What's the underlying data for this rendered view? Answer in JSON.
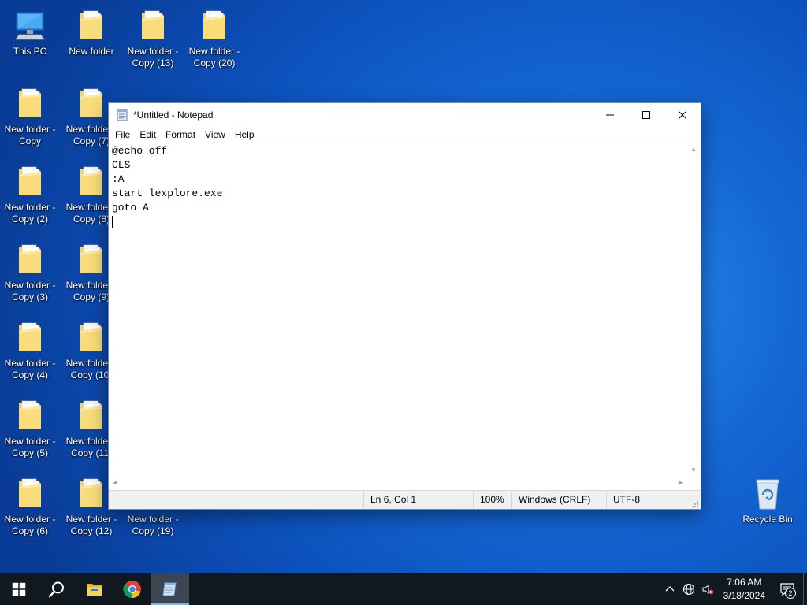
{
  "desktop": {
    "icons": [
      {
        "label": "This PC",
        "type": "pc"
      },
      {
        "label": "New folder",
        "type": "folder"
      },
      {
        "label": "New folder -\nCopy (13)",
        "type": "folder"
      },
      {
        "label": "New folder -\nCopy (20)",
        "type": "folder"
      },
      {
        "label": "New folder -\nCopy",
        "type": "folder"
      },
      {
        "label": "New folder -\nCopy (7)",
        "type": "folder"
      },
      {
        "label": "New folder -\nCopy (2)",
        "type": "folder"
      },
      {
        "label": "New folder -\nCopy (8)",
        "type": "folder"
      },
      {
        "label": "New folder -\nCopy (3)",
        "type": "folder"
      },
      {
        "label": "New folder -\nCopy (9)",
        "type": "folder"
      },
      {
        "label": "New folder -\nCopy (4)",
        "type": "folder"
      },
      {
        "label": "New folder -\nCopy (10)",
        "type": "folder"
      },
      {
        "label": "New folder -\nCopy (5)",
        "type": "folder"
      },
      {
        "label": "New folder -\nCopy (11)",
        "type": "folder"
      },
      {
        "label": "New folder -\nCopy (6)",
        "type": "folder"
      },
      {
        "label": "New folder -\nCopy (12)",
        "type": "folder"
      },
      {
        "label": "New folder -\nCopy (19)",
        "type": "folder"
      },
      {
        "label": "Recycle Bin",
        "type": "recycle-bin"
      }
    ]
  },
  "notepad": {
    "title": "*Untitled - Notepad",
    "menu": [
      "File",
      "Edit",
      "Format",
      "View",
      "Help"
    ],
    "content": "@echo off\nCLS\n:A\nstart lexplore.exe\ngoto A\n",
    "status": {
      "position": "Ln 6, Col 1",
      "zoom": "100%",
      "line_ending": "Windows (CRLF)",
      "encoding": "UTF-8"
    }
  },
  "taskbar": {
    "apps": [
      {
        "name": "start",
        "icon": "windows-logo-icon"
      },
      {
        "name": "search",
        "icon": "search-icon"
      },
      {
        "name": "file-explorer",
        "icon": "folder-icon"
      },
      {
        "name": "chrome",
        "icon": "chrome-icon"
      },
      {
        "name": "notepad",
        "icon": "notepad-icon",
        "active": true
      }
    ],
    "clock": {
      "time": "7:06 AM",
      "date": "3/18/2024"
    },
    "notification_count": "2"
  },
  "colors": {
    "wallpaper": "#1468d6",
    "taskbar": "#101820",
    "active_indicator": "#7ab4ee"
  }
}
